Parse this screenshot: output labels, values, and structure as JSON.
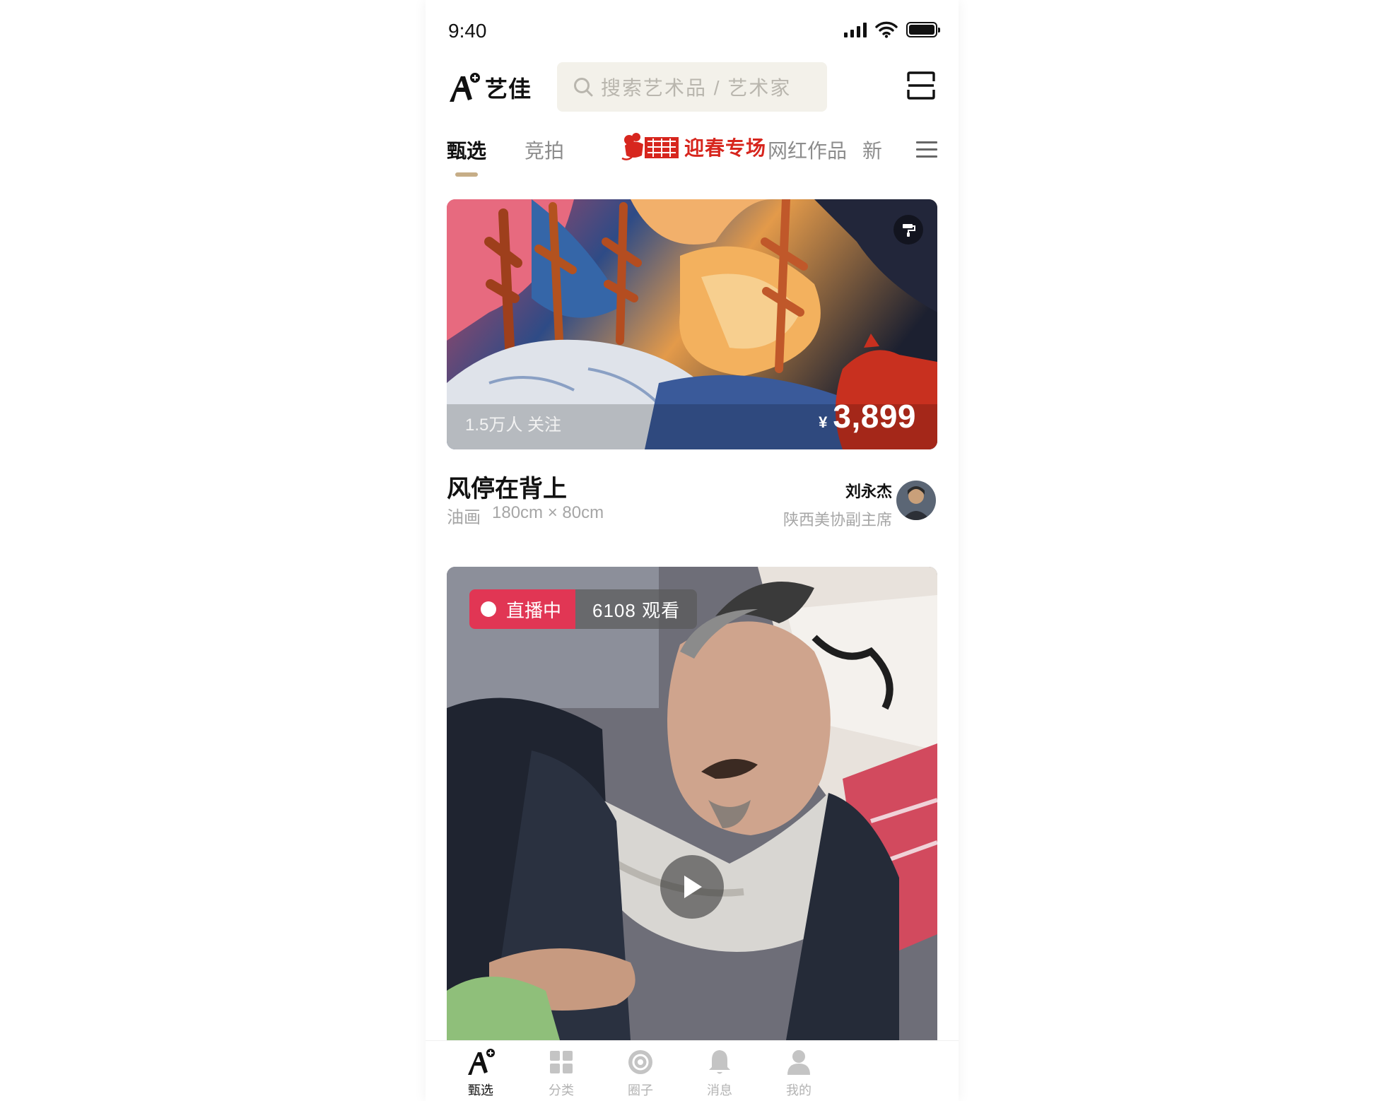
{
  "status_bar": {
    "time": "9:40"
  },
  "header": {
    "logo_text": "艺佳",
    "search_placeholder": "搜索艺术品 / 艺术家"
  },
  "tabs": [
    {
      "label": "甄选",
      "active": true
    },
    {
      "label": "竞拍",
      "active": false
    },
    {
      "label": "迎春专场",
      "active": false,
      "promo": true
    },
    {
      "label": "网红作品",
      "active": false
    },
    {
      "label": "新",
      "active": false
    }
  ],
  "artwork": {
    "followers": "1.5万人 关注",
    "currency": "¥",
    "price": "3,899",
    "title": "风停在背上",
    "medium": "油画",
    "size": "180cm × 80cm",
    "artist_name": "刘永杰",
    "artist_role": "陕西美协副主席"
  },
  "live": {
    "status": "直播中",
    "viewers": "6108 观看"
  },
  "bottom_nav": [
    {
      "label": "甄选",
      "icon": "logo-icon",
      "active": true
    },
    {
      "label": "分类",
      "icon": "grid-icon",
      "active": false
    },
    {
      "label": "圈子",
      "icon": "circle-icon",
      "active": false
    },
    {
      "label": "消息",
      "icon": "bell-icon",
      "active": false
    },
    {
      "label": "我的",
      "icon": "user-icon",
      "active": false
    }
  ],
  "colors": {
    "accent": "#c6ad87",
    "promo_red": "#d7261e",
    "live_red": "#e13654",
    "search_bg": "#f3f1ea"
  }
}
